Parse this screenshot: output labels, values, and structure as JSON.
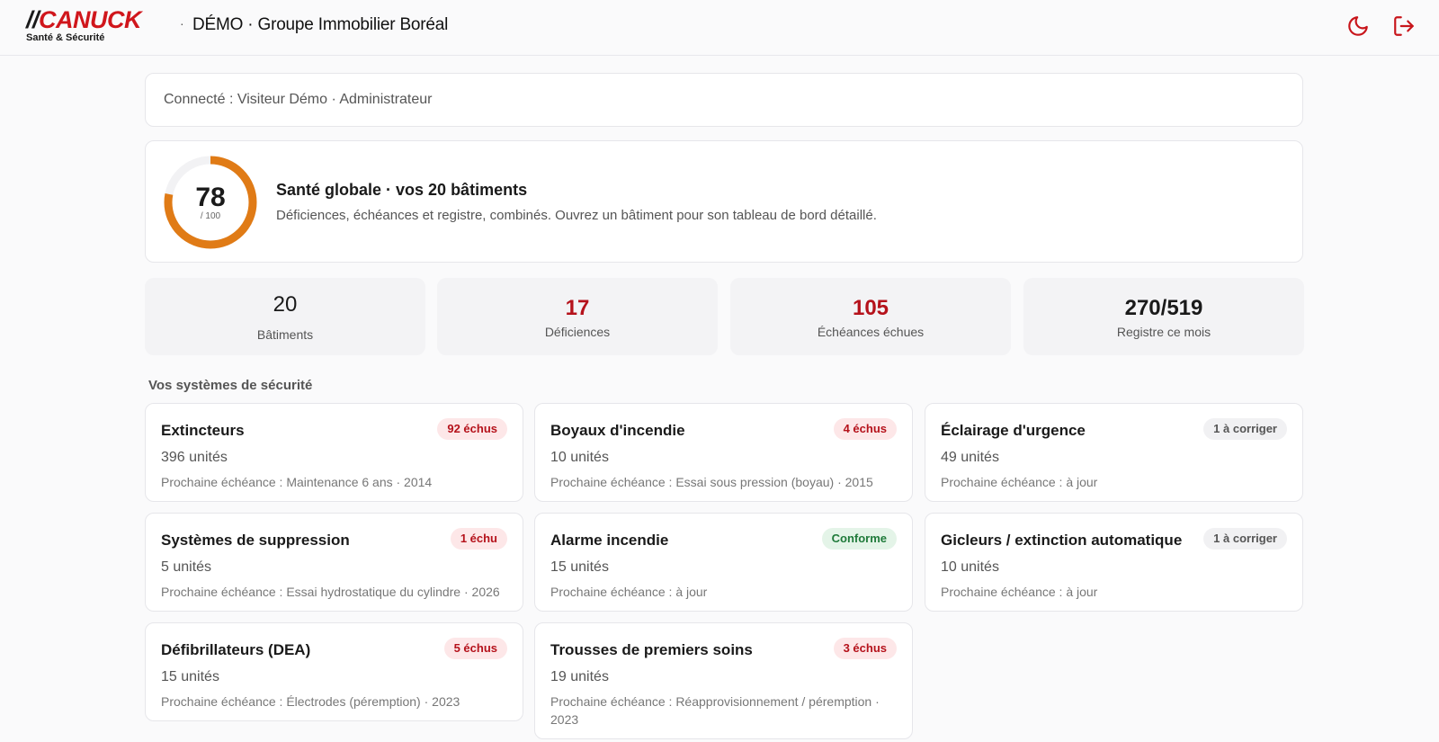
{
  "header": {
    "logo_slashes": "//",
    "logo_brand": "CANUCK",
    "logo_sub": "Santé & Sécurité",
    "separator": "·",
    "title": "DÉMO · Groupe Immobilier Boréal",
    "theme_icon": "moon-icon",
    "logout_icon": "logout-icon",
    "accent_color": "#d0161c"
  },
  "session": {
    "text": "Connecté : Visiteur Démo · Administrateur"
  },
  "health": {
    "score": "78",
    "max": "/ 100",
    "score_fraction": 0.78,
    "gauge_color": "#e07b16",
    "title": "Santé globale · vos 20 bâtiments",
    "description": "Déficiences, échéances et registre, combinés. Ouvrez un bâtiment pour son tableau de bord détaillé."
  },
  "stats": [
    {
      "value": "20",
      "label": "Bâtiments"
    },
    {
      "value": "17",
      "label": "Déficiences"
    },
    {
      "value": "105",
      "label": "Échéances échues"
    },
    {
      "value": "270/519",
      "label": "Registre ce mois"
    }
  ],
  "systems_title": "Vos systèmes de sécurité",
  "systems": [
    {
      "name": "Extincteurs",
      "badge": "92 échus",
      "units": "396 unités",
      "next": "Prochaine échéance : Maintenance 6 ans · 2014"
    },
    {
      "name": "Boyaux d'incendie",
      "badge": "4 échus",
      "units": "10 unités",
      "next": "Prochaine échéance : Essai sous pression (boyau) · 2015"
    },
    {
      "name": "Éclairage d'urgence",
      "badge": "1 à corriger",
      "units": "49 unités",
      "next": "Prochaine échéance : à jour"
    },
    {
      "name": "Systèmes de suppression",
      "badge": "1 échu",
      "units": "5 unités",
      "next": "Prochaine échéance : Essai hydrostatique du cylindre · 2026"
    },
    {
      "name": "Alarme incendie",
      "badge": "Conforme",
      "units": "15 unités",
      "next": "Prochaine échéance : à jour"
    },
    {
      "name": "Gicleurs / extinction automatique",
      "badge": "1 à corriger",
      "units": "10 unités",
      "next": "Prochaine échéance : à jour"
    },
    {
      "name": "Défibrillateurs (DEA)",
      "badge": "5 échus",
      "units": "15 unités",
      "next": "Prochaine échéance : Électrodes (péremption) · 2023"
    },
    {
      "name": "Trousses de premiers soins",
      "badge": "3 échus",
      "units": "19 unités",
      "next": "Prochaine échéance : Réapprovisionnement / péremption · 2023"
    }
  ]
}
